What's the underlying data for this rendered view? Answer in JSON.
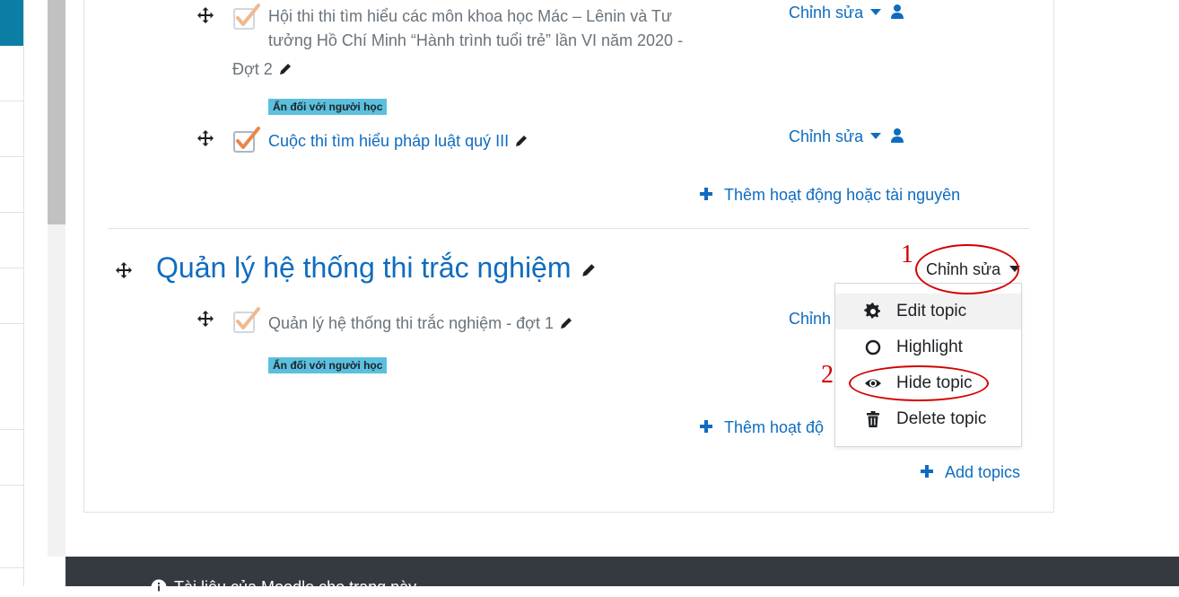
{
  "activities_top": [
    {
      "name_lines": [
        "Hội thi thi tìm hiểu các môn khoa học Mác – Lênin và Tư",
        "tưởng Hồ Chí Minh “Hành trình tuổi trẻ” lần VI năm 2020 -",
        "Đợt 2"
      ],
      "badge": "Ẩn đối với người học",
      "edit_label": "Chỉnh sửa"
    },
    {
      "name": "Cuộc thi tìm hiểu pháp luật quý III",
      "edit_label": "Chỉnh sửa"
    }
  ],
  "add_activity_label": "Thêm hoạt động hoặc tài nguyên",
  "section": {
    "title": "Quản lý hệ thống thi trắc nghiệm",
    "edit_label": "Chỉnh sửa",
    "activity": {
      "name": "Quản lý hệ thống thi trắc nghiệm - đợt 1",
      "badge": "Ẩn đối với người học",
      "edit_label": "Chỉnh"
    },
    "add_activity_label": "Thêm hoạt độ"
  },
  "dropdown": {
    "items": [
      {
        "label": "Edit topic",
        "icon": "gear-icon"
      },
      {
        "label": "Highlight",
        "icon": "circle-icon"
      },
      {
        "label": "Hide topic",
        "icon": "eye-icon"
      },
      {
        "label": "Delete topic",
        "icon": "trash-icon"
      }
    ]
  },
  "add_topics_label": "Add topics",
  "annotations": {
    "one": "1",
    "two": "2"
  },
  "footer": {
    "text": "Tài liệu của Moodle cho trang này"
  },
  "colors": {
    "link": "#0f6cbf",
    "badge": "#5bc0de",
    "annotation": "#d40000",
    "footer": "#343a40"
  }
}
